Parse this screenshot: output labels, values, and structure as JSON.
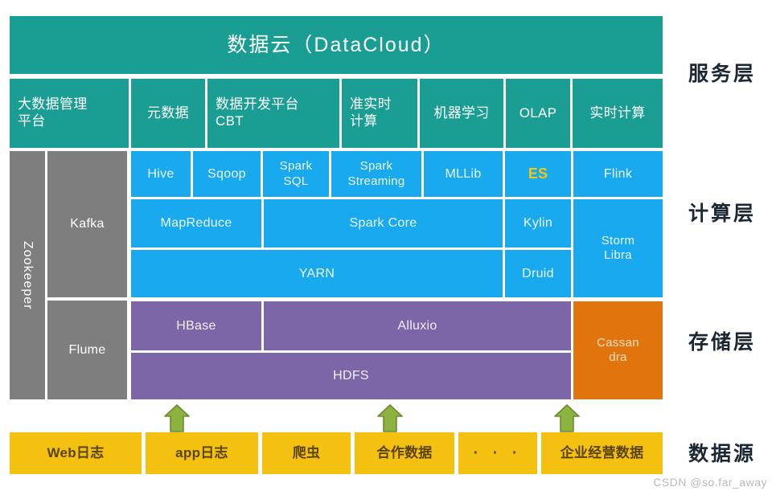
{
  "diagram": {
    "title": "数据云（DataCloud）",
    "watermark": "CSDN @so.far_away",
    "layer_labels": [
      {
        "id": "service",
        "text": "服务层"
      },
      {
        "id": "compute",
        "text": "计算层"
      },
      {
        "id": "storage",
        "text": "存储层"
      },
      {
        "id": "datasource",
        "text": "数据源"
      }
    ],
    "colors": {
      "teal": "#1A9E93",
      "blue": "#18A9EE",
      "grey": "#7E7E7E",
      "purple": "#7C66A8",
      "orange": "#E2740E",
      "yellow": "#F5C111",
      "arrow_green": "#8CB33F",
      "es_highlight": "#F2C811"
    },
    "service_layer": {
      "cloud_banner": "数据云（DataCloud）",
      "modules": [
        "大数据管理\n平台",
        "元数据",
        "数据开发平台\nCBT",
        "准实时\n计算",
        "机器学习",
        "OLAP",
        "实时计算"
      ]
    },
    "sidebar": {
      "zookeeper": "Zookeeper",
      "kafka": "Kafka",
      "flume": "Flume"
    },
    "compute_layer": {
      "row_top": [
        "Hive",
        "Sqoop",
        "Spark\nSQL",
        "Spark\nStreaming",
        "MLLib",
        "ES",
        "Flink"
      ],
      "row_mid": [
        "MapReduce",
        "Spark Core",
        "Kylin"
      ],
      "row_bottom": [
        "YARN",
        "Druid"
      ],
      "right_tall": "Storm\nLibra"
    },
    "storage_layer": {
      "row_top": [
        "HBase",
        "Alluxio"
      ],
      "row_bottom": [
        "HDFS"
      ],
      "right_tall": "Cassan\ndra"
    },
    "data_sources": [
      "Web日志",
      "app日志",
      "爬虫",
      "合作数据",
      "· · ·",
      "企业经营数据"
    ],
    "arrows": [
      {
        "name": "ingest-arrow-1"
      },
      {
        "name": "ingest-arrow-2"
      },
      {
        "name": "ingest-arrow-3"
      }
    ]
  }
}
